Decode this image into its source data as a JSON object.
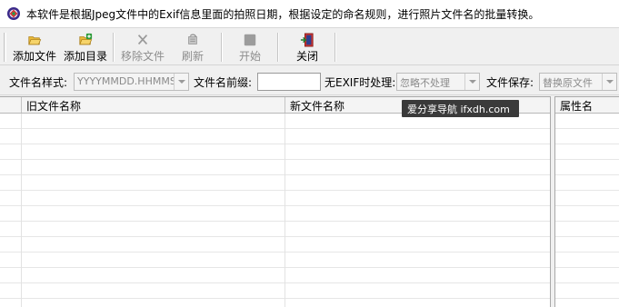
{
  "title": "本软件是根据Jpeg文件中的Exif信息里面的拍照日期，根据设定的命名规则，进行照片文件名的批量转换。",
  "toolbar": {
    "buttons": [
      {
        "label": "添加文件",
        "icon": "open-folder-icon",
        "enabled": true
      },
      {
        "label": "添加目录",
        "icon": "add-folder-icon",
        "enabled": true
      },
      {
        "label": "移除文件",
        "icon": "remove-x-icon",
        "enabled": false
      },
      {
        "label": "刷新",
        "icon": "refresh-icon",
        "enabled": false
      },
      {
        "label": "开始",
        "icon": "stop-square-icon",
        "enabled": false
      },
      {
        "label": "关闭",
        "icon": "exit-door-icon",
        "enabled": true
      }
    ]
  },
  "options": {
    "filename_style_label": "文件名样式:",
    "filename_style_value": "YYYYMMDD.HHMMSS",
    "prefix_label": "文件名前缀:",
    "prefix_value": "",
    "no_exif_label": "无EXIF时处理:",
    "no_exif_value": "忽略不处理",
    "save_label": "文件保存:",
    "save_value": "替换原文件"
  },
  "file_table": {
    "columns": [
      "旧文件名称",
      "新文件名称"
    ]
  },
  "property_panel": {
    "header": "属性名"
  },
  "tooltip": "爱分享导航 ifxdh.com",
  "colors": {
    "tooltip_bg": "#3a3a3a",
    "grid_line": "#e6e6e6",
    "disabled_text": "#8d8d8d"
  }
}
